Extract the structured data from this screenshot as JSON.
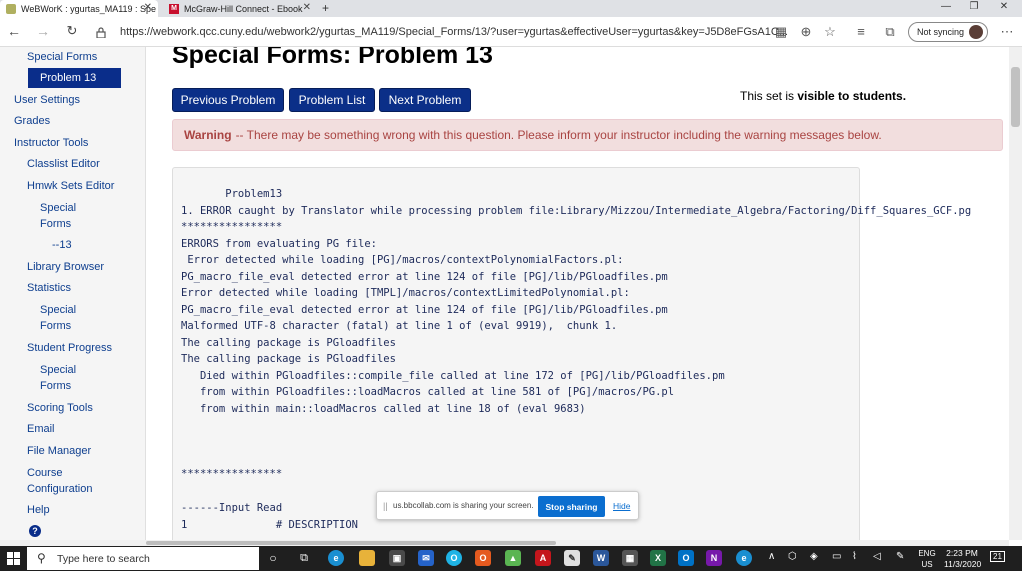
{
  "browser": {
    "tabs": [
      {
        "label": "WeBWorK : ygurtas_MA119 : Spe",
        "active": true,
        "favicon_color": "#b0b060"
      },
      {
        "label": "McGraw-Hill Connect - Ebook",
        "active": false,
        "favicon_color": "#c8102e"
      }
    ],
    "new_tab": "+",
    "url": "https://webwork.qcc.cuny.edu/webwork2/ygurtas_MA119/Special_Forms/13/?user=ygurtas&effectiveUser=ygurtas&key=J5D8eFGsA1C...",
    "profile": "Not syncing"
  },
  "sidebar": {
    "items": [
      {
        "label": "Special Forms"
      },
      {
        "label": "Problem 13"
      },
      {
        "label": "User Settings"
      },
      {
        "label": "Grades"
      },
      {
        "label": "Instructor Tools"
      },
      {
        "label": "Classlist Editor"
      },
      {
        "label": "Hmwk Sets Editor"
      },
      {
        "label": "Special"
      },
      {
        "label": "Forms"
      },
      {
        "label": "--13"
      },
      {
        "label": "Library Browser"
      },
      {
        "label": "Statistics"
      },
      {
        "label": "Special"
      },
      {
        "label": "Forms"
      },
      {
        "label": "Student Progress"
      },
      {
        "label": "Special"
      },
      {
        "label": "Forms"
      },
      {
        "label": "Scoring Tools"
      },
      {
        "label": "Email"
      },
      {
        "label": "File Manager"
      },
      {
        "label": "Course"
      },
      {
        "label": "Configuration"
      },
      {
        "label": "Help"
      }
    ],
    "help_icon": "?"
  },
  "main": {
    "title": "Special Forms: Problem 13",
    "buttons": {
      "previous": "Previous Problem",
      "list": "Problem List",
      "next": "Next Problem"
    },
    "visibility_prefix": "This set is ",
    "visibility_bold": "visible to students.",
    "warning_label": "Warning",
    "warning_text": "-- There may be something wrong with this question. Please inform your instructor including the warning messages below.",
    "error_lines": [
      "       Problem13",
      "1. ERROR caught by Translator while processing problem file:Library/Mizzou/Intermediate_Algebra/Factoring/Diff_Squares_GCF.pg",
      "****************",
      "ERRORS from evaluating PG file:",
      " Error detected while loading [PG]/macros/contextPolynomialFactors.pl:",
      "PG_macro_file_eval detected error at line 124 of file [PG]/lib/PGloadfiles.pm",
      "Error detected while loading [TMPL]/macros/contextLimitedPolynomial.pl:",
      "PG_macro_file_eval detected error at line 124 of file [PG]/lib/PGloadfiles.pm",
      "Malformed UTF-8 character (fatal) at line 1 of (eval 9919),  chunk 1.",
      "The calling package is PGloadfiles",
      "The calling package is PGloadfiles",
      "   Died within PGloadfiles::compile_file called at line 172 of [PG]/lib/PGloadfiles.pm",
      "   from within PGloadfiles::loadMacros called at line 581 of [PG]/macros/PG.pl",
      "   from within main::loadMacros called at line 18 of (eval 9683)",
      "****************",
      "------Input Read",
      "1              # DESCRIPTION"
    ]
  },
  "share_popup": {
    "grip": "||",
    "message": "us.bbcollab.com is sharing your screen.",
    "stop": "Stop sharing",
    "hide": "Hide"
  },
  "taskbar": {
    "search_placeholder": "Type here to search",
    "language": [
      "ENG",
      "US"
    ],
    "time": "2:23 PM",
    "date": "11/3/2020",
    "notification_count": "21"
  },
  "colors": {
    "nav_blue": "#0b2f88",
    "link_blue": "#0f3f8f",
    "warning_bg": "#f2dede",
    "warning_text": "#a94442",
    "stop_sharing": "#0b6ecf"
  }
}
